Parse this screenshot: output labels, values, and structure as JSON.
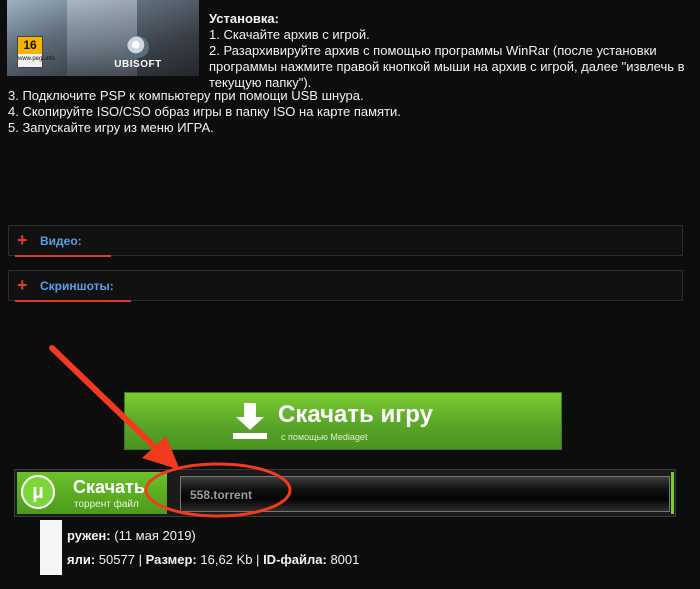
{
  "cover": {
    "age_rating": "16",
    "age_rating_site": "www.pegi.info",
    "publisher": "UBISOFT"
  },
  "install": {
    "title": "Установка:",
    "step1": "1. Скачайте архив с игрой.",
    "step2": "2. Разархивируйте архив с помощью программы WinRar (после установки программы нажмите правой кнопкой мыши на архив с игрой, далее \"извлечь в текущую папку\").",
    "step3": "3. Подключите PSP к компьютеру при помощи USB шнура.",
    "step4": "4. Скопируйте ISO/CSO образ игры в папку ISO на карте памяти.",
    "step5": "5. Запускайте игру из меню ИГРА."
  },
  "spoilers": [
    {
      "label": "Видео:"
    },
    {
      "label": "Скриншоты:"
    }
  ],
  "download_button": {
    "label": "Скачать игру",
    "sublabel": "с помощью Mediaget"
  },
  "torrent": {
    "icon_letter": "µ",
    "label": "Скачать",
    "sublabel": "торрент файл",
    "filename": "558.torrent"
  },
  "meta": {
    "uploaded_label": "ружен:",
    "uploaded_value": "(11 мая 2019)",
    "downloads_label": "яли:",
    "downloads_value": "50577",
    "size_label": "Размер:",
    "size_value": "16,62 Kb",
    "id_label": "ID-файла:",
    "id_value": "8001"
  },
  "colors": {
    "background": "#0d0d0d",
    "accent_red": "#e03a2b",
    "link_blue": "#5aa0e0",
    "button_green": "#5aa72a"
  }
}
